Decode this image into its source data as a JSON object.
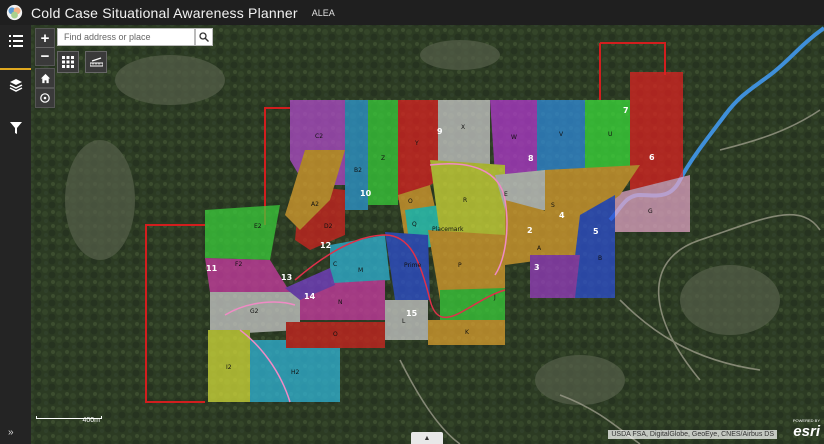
{
  "header": {
    "title": "Cold Case Situational Awareness Planner",
    "subtitle": "ALEA"
  },
  "sidebar": {
    "items": [
      {
        "icon": "legend-list-icon"
      },
      {
        "icon": "layers-icon",
        "active": true
      },
      {
        "icon": "filter-icon"
      }
    ],
    "expand_symbol": "»"
  },
  "map": {
    "zoom_in": "+",
    "zoom_out": "−",
    "search_placeholder": "Find address or place",
    "scale_label": "400m",
    "attribution": "USDA FSA, DigitalGlobe, GeoEye, CNES/Airbus DS",
    "esri_powered": "POWERED BY",
    "esri_name": "esri",
    "bottom_toggle": "▲",
    "zone_labels": {
      "c2": "C2",
      "e2": "E2",
      "f2": "F2",
      "g2": "G2",
      "i2": "I2",
      "h2": "H2",
      "a2": "A2",
      "b2": "B2",
      "d2": "D2",
      "z": "Z",
      "y": "Y",
      "x": "X",
      "w": "W",
      "v": "V",
      "u": "U",
      "q": "Q",
      "r": "R",
      "e": "E",
      "s": "S",
      "a": "A",
      "b": "B",
      "g": "G",
      "m": "M",
      "n": "N",
      "o": "O",
      "l": "L",
      "k": "K",
      "j": "J",
      "p": "P",
      "prime": "Prime",
      "placemark": "Placemark",
      "c": "C"
    },
    "numbered_labels": {
      "n2": "2",
      "n3": "3",
      "n4": "4",
      "n5": "5",
      "n6": "6",
      "n7": "7",
      "n8": "8",
      "n9": "9",
      "n10": "10",
      "n11": "11",
      "n12": "12",
      "n13": "13",
      "n14": "14",
      "n15": "15"
    }
  }
}
